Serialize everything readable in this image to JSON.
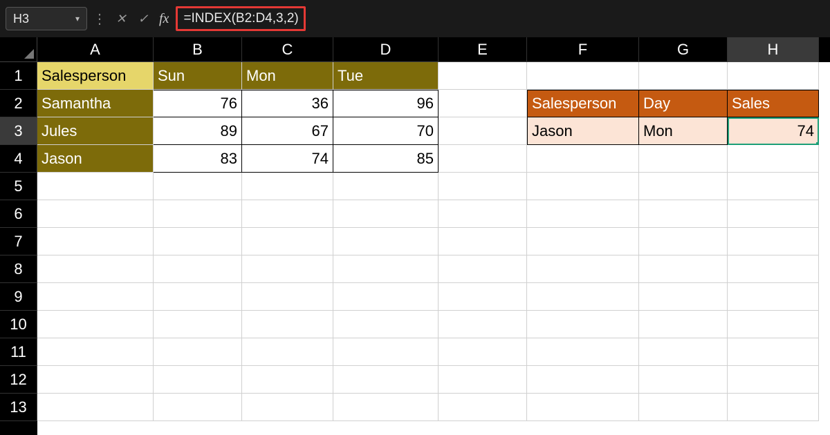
{
  "formula_bar": {
    "cell_ref": "H3",
    "formula": "=INDEX(B2:D4,3,2)"
  },
  "columns": [
    "A",
    "B",
    "C",
    "D",
    "E",
    "F",
    "G",
    "H"
  ],
  "active_column": "H",
  "active_row": "3",
  "row_count": 13,
  "headers": {
    "a1": "Salesperson",
    "b1": "Sun",
    "c1": "Mon",
    "d1": "Tue"
  },
  "salespeople": [
    "Samantha",
    "Jules",
    "Jason"
  ],
  "data": {
    "sun": [
      76,
      89,
      83
    ],
    "mon": [
      36,
      67,
      74
    ],
    "tue": [
      96,
      70,
      85
    ]
  },
  "lookup": {
    "hdr_salesperson": "Salesperson",
    "hdr_day": "Day",
    "hdr_sales": "Sales",
    "salesperson": "Jason",
    "day": "Mon",
    "sales": 74
  },
  "chart_data": {
    "type": "table",
    "title": "",
    "columns": [
      "Salesperson",
      "Sun",
      "Mon",
      "Tue"
    ],
    "rows": [
      [
        "Samantha",
        76,
        36,
        96
      ],
      [
        "Jules",
        89,
        67,
        70
      ],
      [
        "Jason",
        83,
        74,
        85
      ]
    ]
  }
}
